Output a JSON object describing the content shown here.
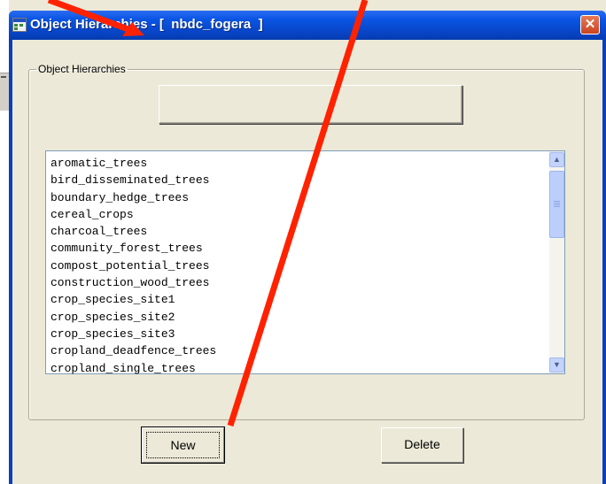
{
  "window": {
    "title": "Object Hierarchies - [  nbdc_fogera  ]",
    "close_label": "✕"
  },
  "group": {
    "legend": "Object Hierarchies",
    "blank_button_label": ""
  },
  "list": {
    "items": [
      "aromatic_trees",
      "bird_disseminated_trees",
      "boundary_hedge_trees",
      "cereal_crops",
      "charcoal_trees",
      "community_forest_trees",
      "compost_potential_trees",
      "construction_wood_trees",
      "crop_species_site1",
      "crop_species_site2",
      "crop_species_site3",
      "cropland_deadfence_trees",
      "cropland_single_trees"
    ],
    "scroll_up": "▲",
    "scroll_down": "▼"
  },
  "buttons": {
    "new_label": "New",
    "delete_label": "Delete"
  },
  "annotation_color": "#ff2200"
}
